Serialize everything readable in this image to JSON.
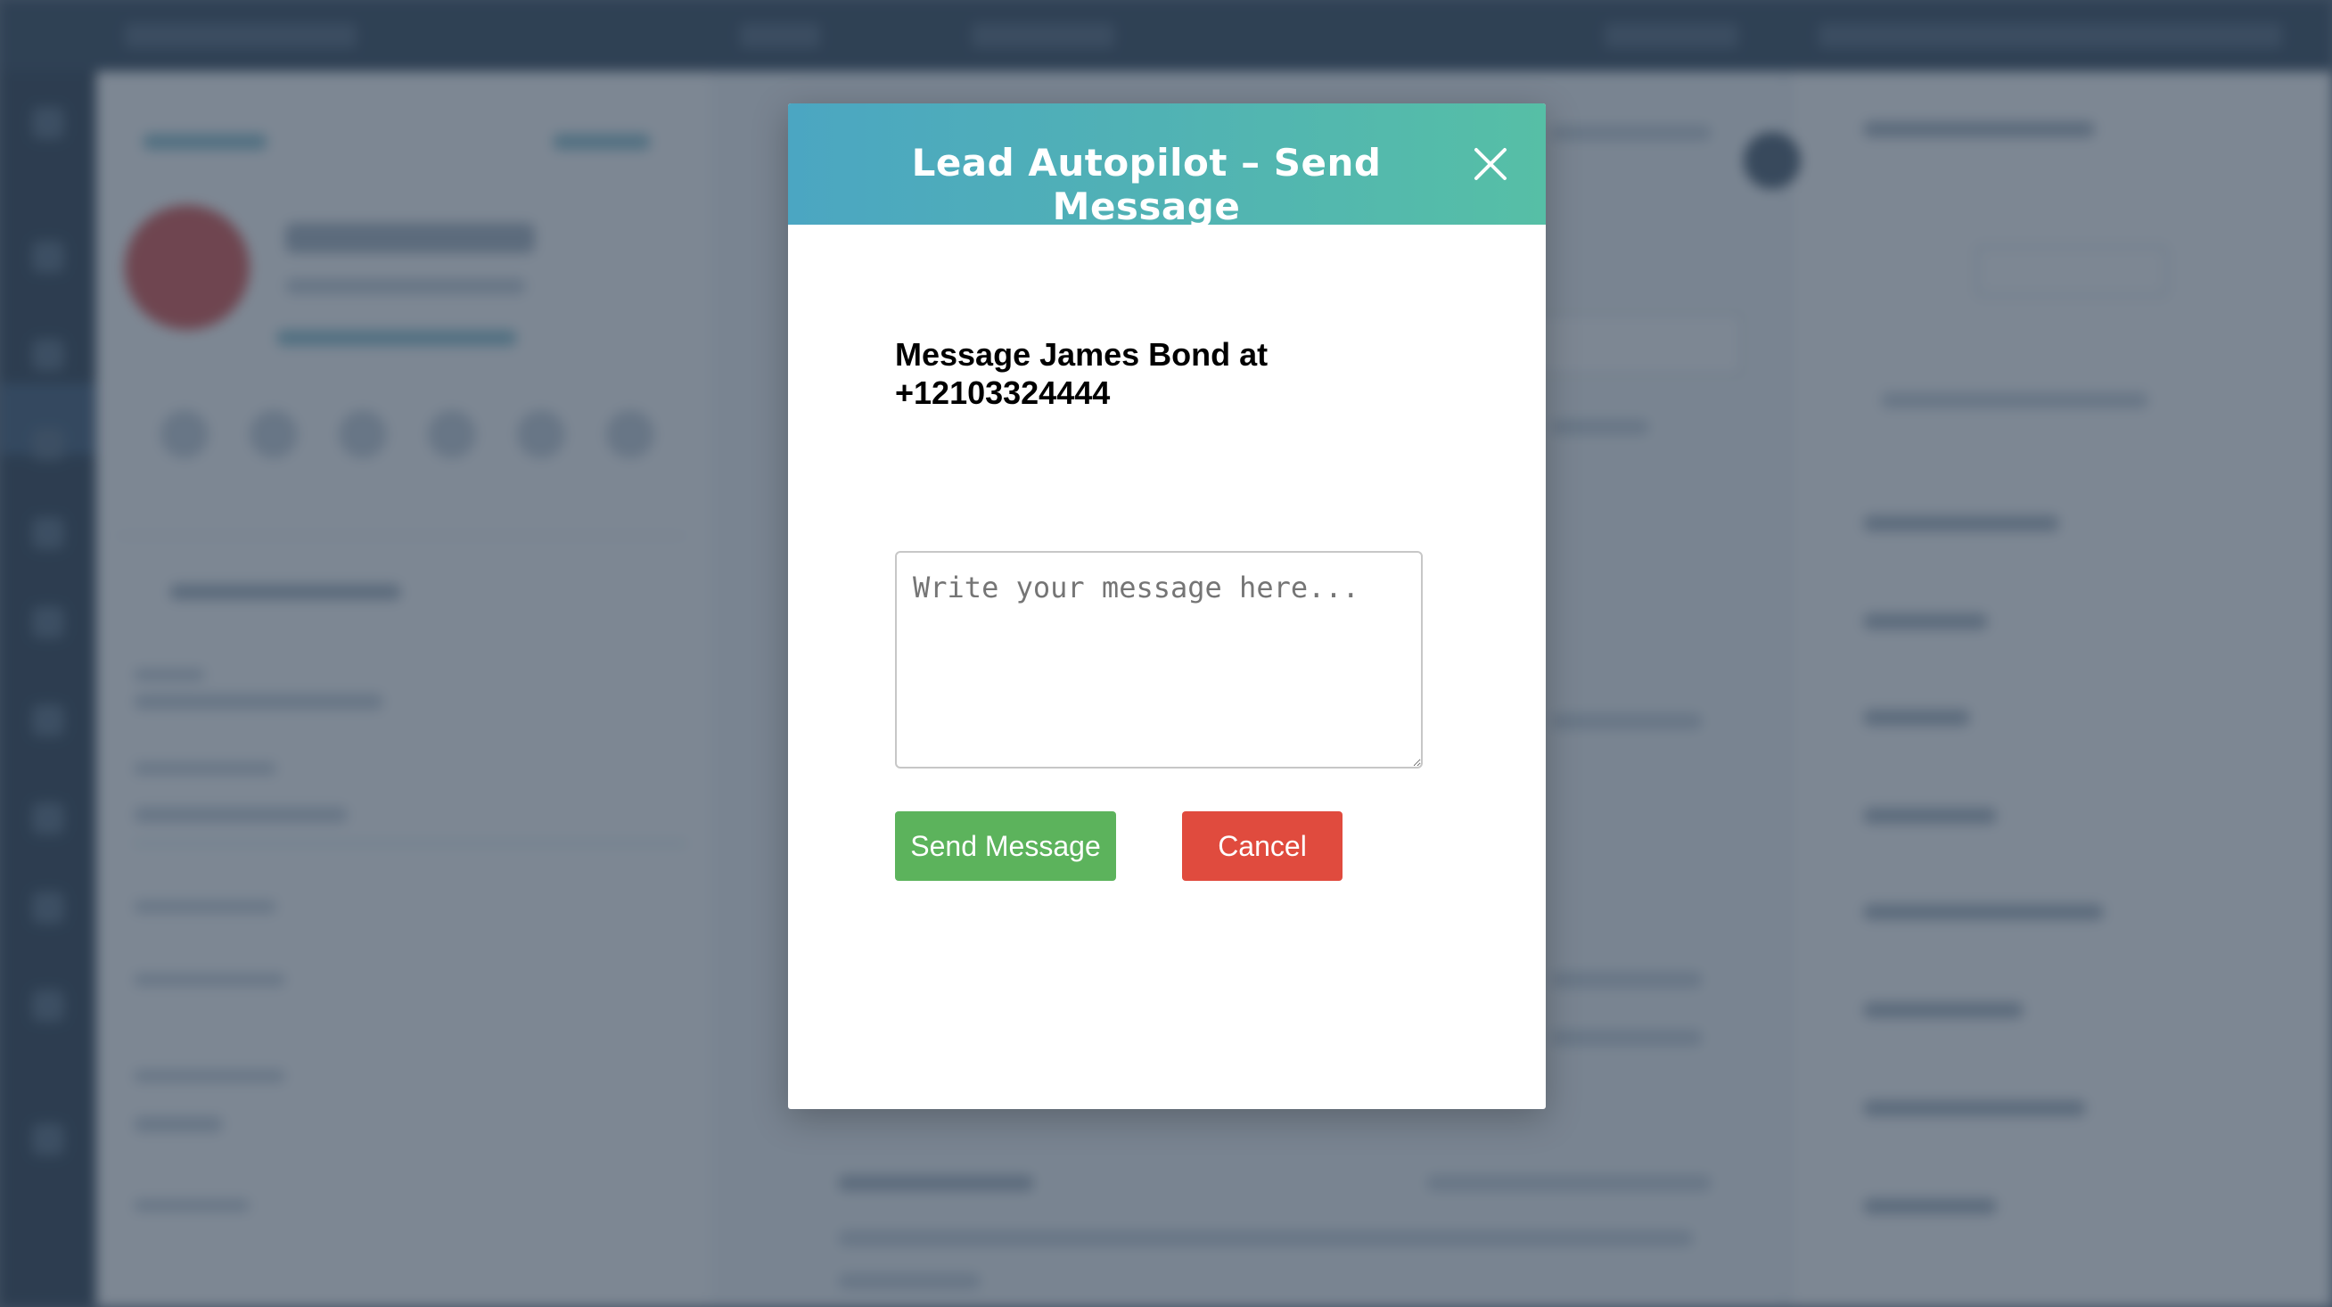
{
  "modal": {
    "title": "Lead Autopilot – Send Message",
    "close_icon": "close-icon",
    "recipient_prefix": "Message James Bond at",
    "recipient_phone": "+12103324444",
    "message_placeholder": "Write your message here...",
    "send_label": "Send Message",
    "cancel_label": "Cancel"
  },
  "colors": {
    "header_gradient_start": "#4ba6c2",
    "header_gradient_end": "#56bfa6",
    "send_button": "#5cb35c",
    "cancel_button": "#e04b3e",
    "overlay": "#2d3e50"
  }
}
